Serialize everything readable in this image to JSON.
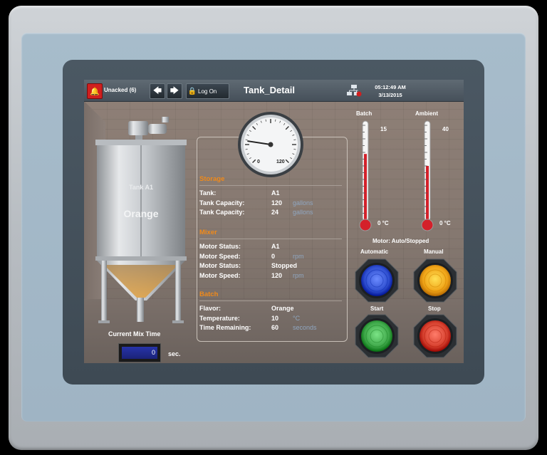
{
  "topbar": {
    "alarm_label": "Unacked (6)",
    "logon_label": "Log On",
    "title": "Tank_Detail",
    "time": "05:12:49 AM",
    "date": "3/13/2015"
  },
  "tank": {
    "name": "Tank A1",
    "content": "Orange"
  },
  "mix": {
    "label": "Current Mix Time",
    "value": "0",
    "unit": "sec."
  },
  "gauge": {
    "min_label": "0",
    "max_label": "120",
    "value_fraction": 0.05
  },
  "storage": {
    "title": "Storage",
    "rows": [
      {
        "label": "Tank:",
        "value": "A1",
        "unit": ""
      },
      {
        "label": "Tank Capacity:",
        "value": "120",
        "unit": "gallons"
      },
      {
        "label": "Tank Capacity:",
        "value": "24",
        "unit": "gallons"
      }
    ]
  },
  "mixer": {
    "title": "Mixer",
    "rows": [
      {
        "label": "Motor Status:",
        "value": "A1",
        "unit": ""
      },
      {
        "label": "Motor Speed:",
        "value": "0",
        "unit": "rpm"
      },
      {
        "label": "Motor Status:",
        "value": "Stopped",
        "unit": ""
      },
      {
        "label": "Motor Speed:",
        "value": "120",
        "unit": "rpm"
      }
    ]
  },
  "batch": {
    "title": "Batch",
    "rows": [
      {
        "label": "Flavor:",
        "value": "Orange",
        "unit": ""
      },
      {
        "label": "Temperature:",
        "value": "10",
        "unit": "°C"
      },
      {
        "label": "Time Remaining:",
        "value": "60",
        "unit": "seconds"
      }
    ]
  },
  "thermometers": [
    {
      "label": "Batch",
      "top_value": "15",
      "bottom_value": "0 °C",
      "fill_fraction": 0.67
    },
    {
      "label": "Ambient",
      "top_value": "40",
      "bottom_value": "0 °C",
      "fill_fraction": 0.55
    }
  ],
  "motor_status": "Motor: Auto/Stopped",
  "buttons": [
    {
      "label": "Automatic",
      "color": "#2f4fd0"
    },
    {
      "label": "Manual",
      "color": "#f0a418"
    },
    {
      "label": "Start",
      "color": "#3fa84a"
    },
    {
      "label": "Stop",
      "color": "#d6402e"
    }
  ],
  "colors": {
    "section_title": "#f08a1a",
    "unit_text": "#8fa6c0",
    "alarm": "#d01f1f"
  }
}
